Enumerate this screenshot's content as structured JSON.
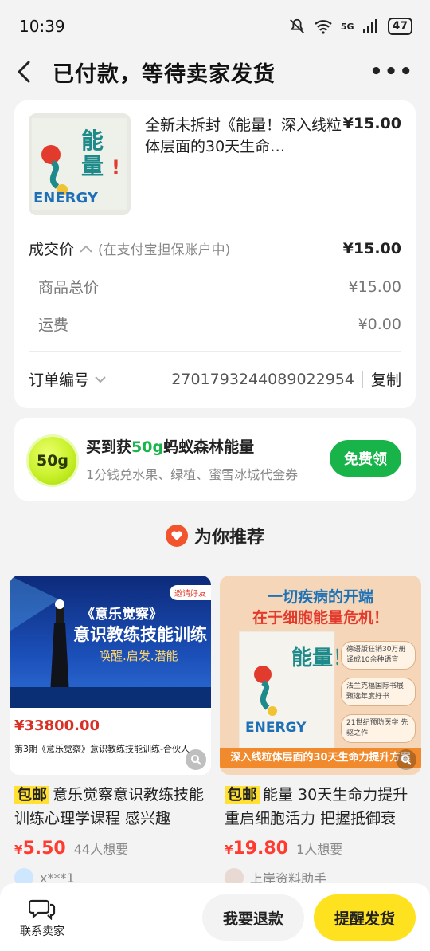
{
  "status_bar": {
    "time": "10:39",
    "signal": "5G",
    "battery": "47"
  },
  "nav": {
    "title": "已付款，等待卖家发货",
    "back_icon": "chevron-left-icon",
    "more_icon": "more-icon"
  },
  "order": {
    "product_title": "全新未拆封《能量！深入线粒体层面的30天生命…",
    "product_price": "¥15.00",
    "product_image_text": "ENERGY",
    "deal_label": "成交价",
    "deal_note": "(在支付宝担保账户中)",
    "deal_value": "¥15.00",
    "goods_total_label": "商品总价",
    "goods_total_value": "¥15.00",
    "shipping_label": "运费",
    "shipping_value": "¥0.00",
    "order_no_label": "订单编号",
    "order_no": "2701793244089022954",
    "copy_label": "复制"
  },
  "energy": {
    "badge": "50g",
    "title_prefix": "买到获",
    "title_highlight": "50g",
    "title_suffix": "蚂蚁森林能量",
    "subtitle": "1分钱兑水果、绿植、蜜雪冰城代金券",
    "button": "免费领"
  },
  "recommend": {
    "heading": "为你推荐",
    "items": [
      {
        "img_line1": "《意乐觉察》",
        "img_line2": "意识教练技能训练",
        "img_line3": "唤醒.启发.潜能",
        "img_corner": "邀请好友",
        "img_price": "¥33800.00",
        "img_caption": "第3期《意乐觉察》意识教练技能训练-合伙人",
        "tag": "包邮",
        "desc": "意乐觉察意识教练技能训练心理学课程 感兴趣",
        "price_symbol": "¥",
        "price": "5.50",
        "want": "44人想要",
        "seller": "x***1"
      },
      {
        "img_line1": "一切疾病的开端",
        "img_line2": "在于细胞能量危机！",
        "img_line3": "深入线粒体层面的30天生命力提升方案",
        "img_book_title": "能量！",
        "img_book_word": "ENERGY",
        "img_bullets": [
          "德语版狂销30万册 译成10余种语言",
          "法兰克福国际书展 甄选年度好书",
          "21世纪预防医学 先驱之作"
        ],
        "tag": "包邮",
        "desc": "能量 30天生命力提升 重启细胞活力 把握抵御衰",
        "price_symbol": "¥",
        "price": "19.80",
        "want": "1人想要",
        "seller": "上岸资料助手"
      }
    ]
  },
  "bottom_bar": {
    "contact_label": "联系卖家",
    "refund_label": "我要退款",
    "remind_label": "提醒发货"
  },
  "colors": {
    "accent_yellow": "#ffe21f",
    "green": "#18b449",
    "price_red": "#ff3b30"
  }
}
